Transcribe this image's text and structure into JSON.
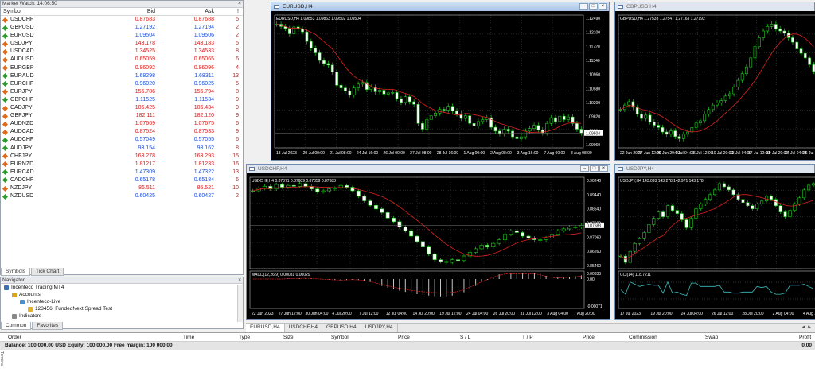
{
  "market_watch": {
    "title": "Market Watch: 14:06:50",
    "close": "×",
    "headers": {
      "symbol": "Symbol",
      "bid": "Bid",
      "ask": "Ask",
      "spread": "!"
    },
    "rows": [
      {
        "symbol": "USDCHF",
        "bid": "0.87683",
        "ask": "0.87688",
        "spread": "5",
        "dir": "dn"
      },
      {
        "symbol": "GBPUSD",
        "bid": "1.27192",
        "ask": "1.27194",
        "spread": "2",
        "dir": "up"
      },
      {
        "symbol": "EURUSD",
        "bid": "1.09504",
        "ask": "1.09506",
        "spread": "2",
        "dir": "up"
      },
      {
        "symbol": "USDJPY",
        "bid": "143.178",
        "ask": "143.183",
        "spread": "5",
        "dir": "dn"
      },
      {
        "symbol": "USDCAD",
        "bid": "1.34525",
        "ask": "1.34533",
        "spread": "8",
        "dir": "dn"
      },
      {
        "symbol": "AUDUSD",
        "bid": "0.65059",
        "ask": "0.65065",
        "spread": "6",
        "dir": "dn"
      },
      {
        "symbol": "EURGBP",
        "bid": "0.86092",
        "ask": "0.86096",
        "spread": "4",
        "dir": "dn"
      },
      {
        "symbol": "EURAUD",
        "bid": "1.68298",
        "ask": "1.68311",
        "spread": "13",
        "dir": "up"
      },
      {
        "symbol": "EURCHF",
        "bid": "0.96020",
        "ask": "0.96025",
        "spread": "5",
        "dir": "up"
      },
      {
        "symbol": "EURJPY",
        "bid": "156.786",
        "ask": "156.794",
        "spread": "8",
        "dir": "dn"
      },
      {
        "symbol": "GBPCHF",
        "bid": "1.11525",
        "ask": "1.11534",
        "spread": "9",
        "dir": "up"
      },
      {
        "symbol": "CADJPY",
        "bid": "106.425",
        "ask": "106.434",
        "spread": "9",
        "dir": "dn"
      },
      {
        "symbol": "GBPJPY",
        "bid": "182.111",
        "ask": "182.120",
        "spread": "9",
        "dir": "dn"
      },
      {
        "symbol": "AUDNZD",
        "bid": "1.07669",
        "ask": "1.07675",
        "spread": "6",
        "dir": "dn"
      },
      {
        "symbol": "AUDCAD",
        "bid": "0.87524",
        "ask": "0.87533",
        "spread": "9",
        "dir": "dn"
      },
      {
        "symbol": "AUDCHF",
        "bid": "0.57049",
        "ask": "0.57055",
        "spread": "6",
        "dir": "up"
      },
      {
        "symbol": "AUDJPY",
        "bid": "93.154",
        "ask": "93.162",
        "spread": "8",
        "dir": "up"
      },
      {
        "symbol": "CHFJPY",
        "bid": "163.278",
        "ask": "163.293",
        "spread": "15",
        "dir": "dn"
      },
      {
        "symbol": "EURNZD",
        "bid": "1.81217",
        "ask": "1.81233",
        "spread": "16",
        "dir": "dn"
      },
      {
        "symbol": "EURCAD",
        "bid": "1.47309",
        "ask": "1.47322",
        "spread": "13",
        "dir": "up"
      },
      {
        "symbol": "CADCHF",
        "bid": "0.65178",
        "ask": "0.65184",
        "spread": "6",
        "dir": "up"
      },
      {
        "symbol": "NZDJPY",
        "bid": "86.511",
        "ask": "86.521",
        "spread": "10",
        "dir": "dn"
      },
      {
        "symbol": "NZDUSD",
        "bid": "0.60425",
        "ask": "0.60427",
        "spread": "2",
        "dir": "up"
      }
    ],
    "tabs": [
      "Symbols",
      "Tick Chart"
    ]
  },
  "navigator": {
    "title": "Navigator",
    "close": "×",
    "items": [
      {
        "label": "Incenteco Trading MT4",
        "level": 0,
        "icon": "terminal-icon"
      },
      {
        "label": "Accounts",
        "level": 1,
        "icon": "accounts-icon"
      },
      {
        "label": "Incenteco-Live",
        "level": 2,
        "icon": "server-icon"
      },
      {
        "label": "123456: FundedNext Spread Test",
        "level": 3,
        "icon": "account-icon"
      },
      {
        "label": "Indicators",
        "level": 1,
        "icon": "indicators-icon"
      }
    ],
    "tabs": [
      "Common",
      "Favorites"
    ]
  },
  "charts": {
    "eurusd": {
      "title": "EURUSD,H4",
      "info": "EURUSD,H4  1.09853 1.09863 1.09502 1.09504",
      "price_labels": [
        "1.12490",
        "1.12100",
        "1.11720",
        "1.11340",
        "1.10960",
        "1.10580",
        "1.10200",
        "1.09820",
        "1.09504",
        "1.09060"
      ],
      "current": "1.09504",
      "time_labels": [
        "18 Jul 2023",
        "20 Jul 00:00",
        "21 Jul 08:00",
        "24 Jul 16:00",
        "26 Jul 00:00",
        "27 Jul 08:00",
        "28 Jul 16:00",
        "1 Aug 00:00",
        "2 Aug 08:00",
        "3 Aug 16:00",
        "7 Aug 00:00",
        "8 Aug 08:00"
      ],
      "close_series": [
        1.1235,
        1.1229,
        1.1224,
        1.121,
        1.1228,
        1.1222,
        1.1215,
        1.119,
        1.1172,
        1.116,
        1.114,
        1.1132,
        1.1128,
        1.111,
        1.1075,
        1.1068,
        1.106,
        1.105,
        1.1068,
        1.1078,
        1.1082,
        1.1064,
        1.107,
        1.1058,
        1.1062,
        1.1052,
        1.1055,
        1.1056,
        1.104,
        1.103,
        1.1045,
        1.1032,
        1.1025,
        1.0975,
        1.096,
        1.0985,
        1.0995,
        1.1002,
        1.1012,
        1.101,
        1.102,
        1.1008,
        1.1,
        1.0988,
        1.0995,
        1.0975,
        1.0968,
        1.098,
        1.0985,
        1.099,
        1.0965,
        1.0955,
        1.0948,
        1.096,
        1.0955,
        1.094,
        1.0935,
        1.094,
        1.0955,
        1.0962,
        1.097,
        1.0958,
        1.095,
        1.0975,
        1.099,
        1.098,
        1.0994,
        1.0985,
        1.0992,
        1.0975,
        1.096,
        1.095
      ]
    },
    "gbpusd": {
      "title": "GBPUSD,H4",
      "info": "GBPUSD,H4  1.27533 1.27547 1.27163 1.27192",
      "time_labels": [
        "22 Jun 2023",
        "27 Jun 12:00",
        "29 Jun 20:00",
        "4 Jul 04:00",
        "6 Jul 12:00",
        "10 Jul 20:00",
        "13 Jul 04:00",
        "17 Jul 12:00",
        "19 Jul 20:00",
        "24 Jul 04:00",
        "26 Jul 12:00"
      ],
      "close_series": [
        1.276,
        1.278,
        1.2795,
        1.277,
        1.274,
        1.272,
        1.2735,
        1.2705,
        1.269,
        1.268,
        1.266,
        1.265,
        1.2665,
        1.264,
        1.263,
        1.265,
        1.266,
        1.268,
        1.27,
        1.271,
        1.274,
        1.276,
        1.278,
        1.279,
        1.28,
        1.282,
        1.283,
        1.286,
        1.289,
        1.292,
        1.295,
        1.299,
        1.304,
        1.308,
        1.311,
        1.313,
        1.314,
        1.312,
        1.311,
        1.31,
        1.308,
        1.306,
        1.303,
        1.301,
        1.299,
        1.296,
        1.293
      ]
    },
    "usdchf": {
      "title": "USDCHF,H4",
      "info": "USDCHF,H4  0.87371 0.87689 0.87359 0.87683",
      "price_labels": [
        "0.90240",
        "0.89440",
        "0.88640",
        "0.87683",
        "0.87060",
        "0.86260",
        "0.85460"
      ],
      "current": "0.87683",
      "macd_info": "MACD(12,26,9) 0.00031 0.00029",
      "macd_labels": [
        "0.00333",
        "0.00",
        "-0.00071"
      ],
      "time_labels": [
        "22 Jun 2023",
        "27 Jun 12:00",
        "30 Jun 04:00",
        "4 Jul 20:00",
        "7 Jul 12:00",
        "12 Jul 04:00",
        "14 Jul 20:00",
        "19 Jul 12:00",
        "24 Jul 04:00",
        "26 Jul 20:00",
        "31 Jul 12:00",
        "3 Aug 04:00",
        "7 Aug 20:00"
      ],
      "close_series": [
        0.896,
        0.8975,
        0.8985,
        0.897,
        0.8995,
        0.898,
        0.899,
        0.8985,
        0.9,
        0.8985,
        0.897,
        0.8955,
        0.896,
        0.897,
        0.8975,
        0.899,
        0.898,
        0.896,
        0.893,
        0.8905,
        0.888,
        0.886,
        0.884,
        0.881,
        0.879,
        0.876,
        0.874,
        0.871,
        0.868,
        0.865,
        0.861,
        0.858,
        0.857,
        0.8565,
        0.858,
        0.8575,
        0.86,
        0.862,
        0.864,
        0.866,
        0.865,
        0.867,
        0.869,
        0.872,
        0.874,
        0.873,
        0.871,
        0.87,
        0.869,
        0.869,
        0.87,
        0.872,
        0.874,
        0.875,
        0.876,
        0.876,
        0.877
      ]
    },
    "usdjpy": {
      "title": "USDJPY,H4",
      "info": "USDJPY,H4  143.093 143.278 142.971 143.178",
      "cci_info": "CCI(14) 118.7211",
      "time_labels": [
        "17 Jul 2023",
        "19 Jul 20:00",
        "24 Jul 04:00",
        "26 Jul 12:00",
        "28 Jul 20:00",
        "2 Aug 04:00",
        "4 Aug 12:00"
      ],
      "close_series": [
        138.6,
        138.2,
        138.9,
        139.4,
        139.7,
        140.1,
        140.6,
        141.0,
        141.4,
        141.1,
        141.8,
        141.5,
        141.3,
        140.9,
        140.4,
        141.0,
        141.6,
        141.9,
        142.2,
        142.5,
        142.8,
        143.2,
        143.0,
        142.8,
        142.5,
        142.2,
        142.0,
        141.8,
        141.6,
        141.9,
        142.1,
        142.4,
        142.2,
        141.8,
        141.4,
        141.1,
        141.5,
        141.9,
        142.3,
        142.8,
        143.1,
        143.2
      ]
    }
  },
  "chart_tabs": [
    "EURUSD,H4",
    "USDCHF,H4",
    "GBPUSD,H4",
    "USDJPY,H4"
  ],
  "chart_tab_arrows": "◄ ►",
  "terminal": {
    "headers": [
      "Order",
      "Time",
      "Type",
      "Size",
      "Symbol",
      "Price",
      "S / L",
      "T / P",
      "Price",
      "Commission",
      "Swap",
      "Profit"
    ],
    "balance": "Balance: 100 000.00 USD  Equity: 100 000.00  Free margin: 100 000.00",
    "profit": "0.00",
    "side_label": "Terminal"
  },
  "window_buttons": {
    "min": "–",
    "max": "□",
    "close": "×"
  }
}
